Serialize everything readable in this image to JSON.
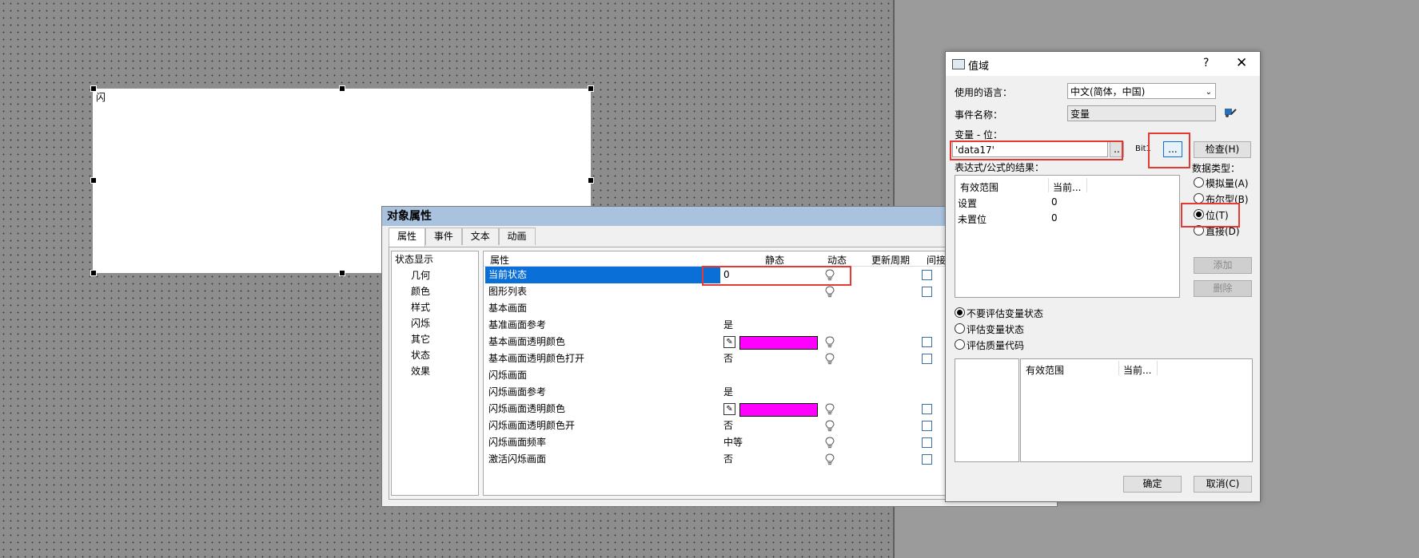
{
  "canvas": {
    "object_label": "闪"
  },
  "properties": {
    "title": "对象属性",
    "tabs": [
      "属性",
      "事件",
      "文本",
      "动画"
    ],
    "tree": [
      "状态显示",
      "几何",
      "颜色",
      "样式",
      "闪烁",
      "其它",
      "状态",
      "效果"
    ],
    "columns": {
      "name": "属性",
      "static": "静态",
      "dynamic": "动态",
      "update": "更新周期",
      "indirect": "间接"
    },
    "rows": [
      {
        "name": "当前状态",
        "value": "0",
        "bulb": true,
        "cb": true
      },
      {
        "name": "图形列表",
        "value": "",
        "bulb": true,
        "cb": true
      },
      {
        "name": "基本画面",
        "value": "",
        "bulb": false,
        "cb": false
      },
      {
        "name": "基准画面参考",
        "value": "是",
        "bulb": false,
        "cb": false
      },
      {
        "name": "基本画面透明颜色",
        "value": "",
        "bulb": true,
        "cb": true
      },
      {
        "name": "基本画面透明颜色打开",
        "value": "否",
        "bulb": true,
        "cb": true
      },
      {
        "name": "闪烁画面",
        "value": "",
        "bulb": false,
        "cb": false
      },
      {
        "name": "闪烁画面参考",
        "value": "是",
        "bulb": false,
        "cb": false
      },
      {
        "name": "闪烁画面透明颜色",
        "value": "",
        "bulb": true,
        "cb": true
      },
      {
        "name": "闪烁画面透明颜色开",
        "value": "否",
        "bulb": true,
        "cb": true
      },
      {
        "name": "闪烁画面频率",
        "value": "中等",
        "bulb": true,
        "cb": true
      },
      {
        "name": "激活闪烁画面",
        "value": "否",
        "bulb": true,
        "cb": true
      }
    ],
    "swatch_color": "#ff00ff"
  },
  "dialog": {
    "title": "值域",
    "help": "?",
    "close": "✕",
    "language_label": "使用的语言：",
    "language_value": "中文(简体，中国)",
    "event_label": "事件名称：",
    "event_value": "变量",
    "var_label": "变量 - 位：",
    "var_value": "'data17'",
    "var_dots": "..",
    "bit_label": "Bit1",
    "browse": "...",
    "check": "检查(H)",
    "expr_label": "表达式/公式的结果：",
    "datatype_label": "数据类型：",
    "list1_cols": [
      "有效范围",
      "当前..."
    ],
    "list1_rows": [
      {
        "name": "设置",
        "val": "0"
      },
      {
        "name": "未置位",
        "val": "0"
      }
    ],
    "types": [
      "模拟量(A)",
      "布尔型(B)",
      "位(T)",
      "直接(D)"
    ],
    "add": "添加",
    "delete": "删除",
    "eval_options": [
      "不要评估变量状态",
      "评估变量状态",
      "评估质量代码"
    ],
    "list2_cols": [
      "有效范围",
      "当前..."
    ],
    "ok": "确定",
    "cancel": "取消(C)"
  }
}
